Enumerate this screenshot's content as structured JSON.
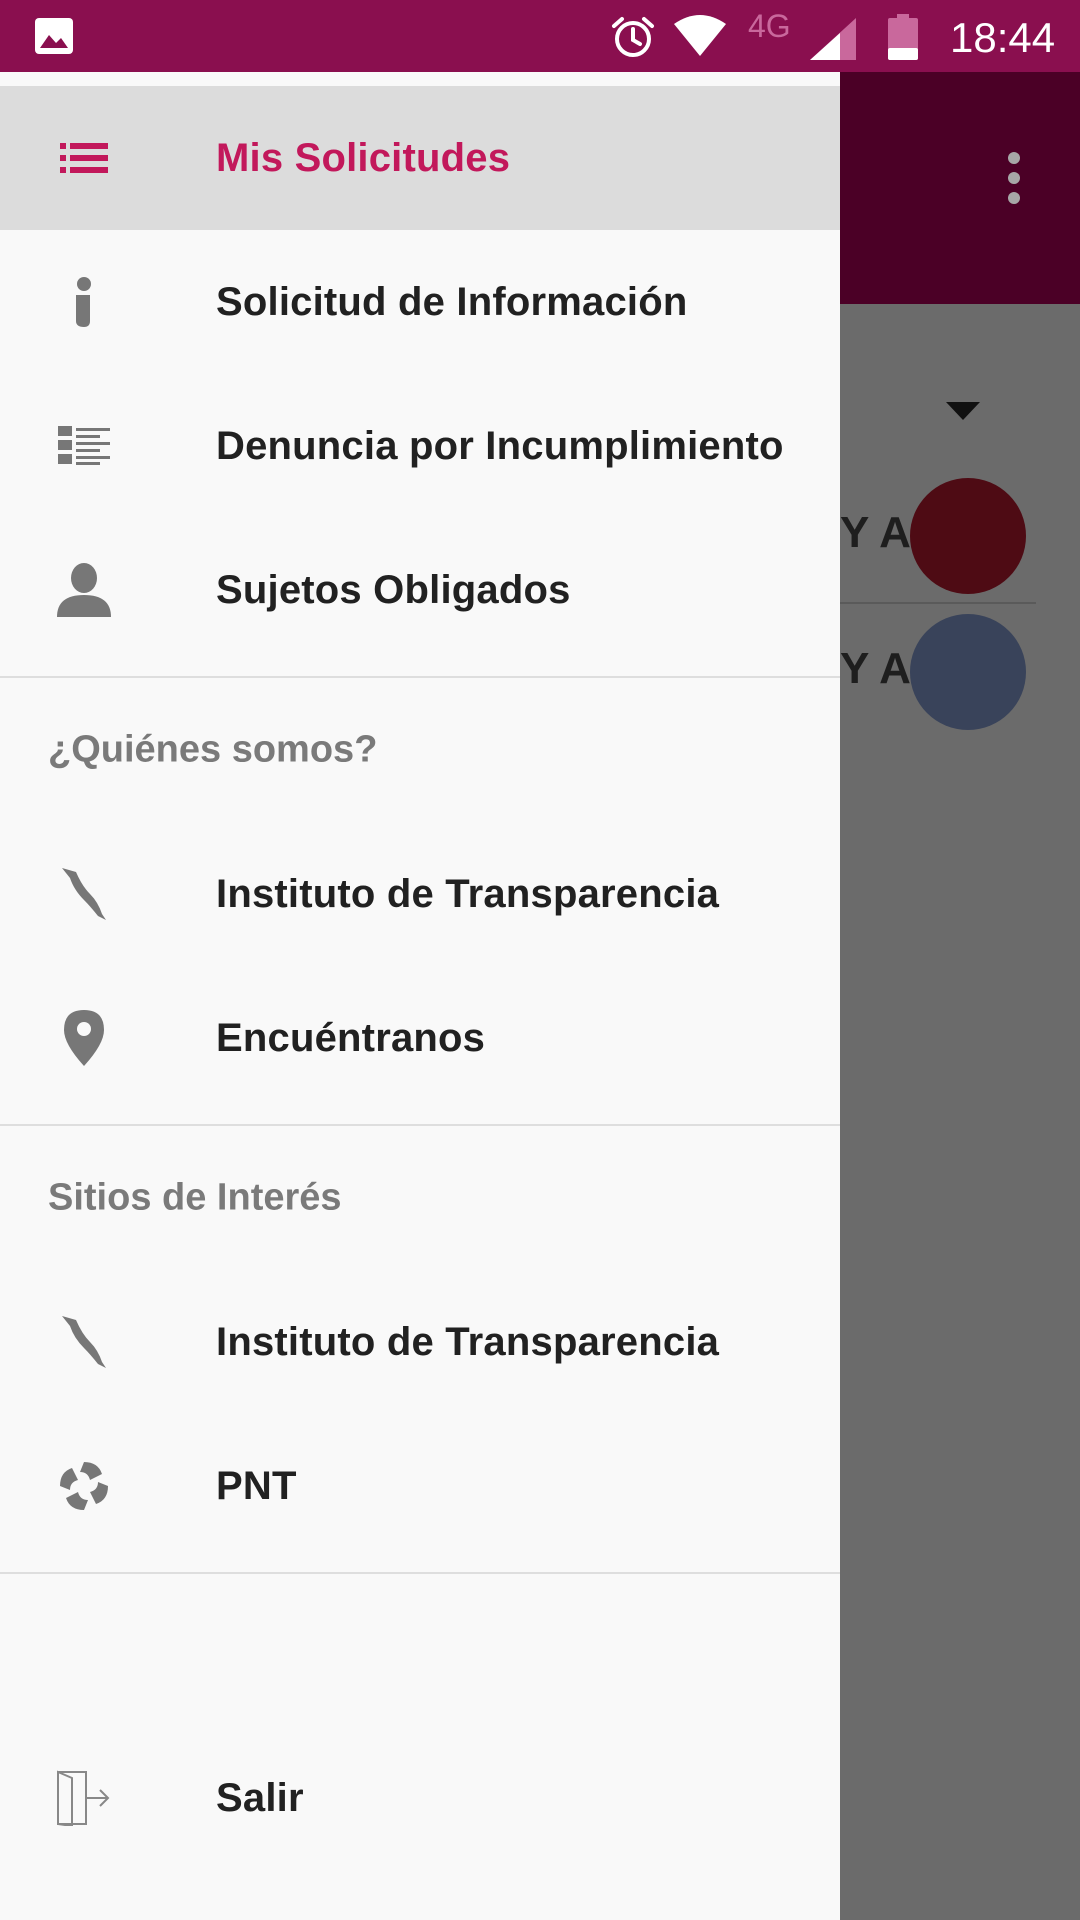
{
  "status_bar": {
    "network": "4G",
    "time": "18:44"
  },
  "background_app": {
    "row1_text": "Y A",
    "row2_text": "Y A",
    "colors": {
      "toolbar": "#4b0026",
      "avatar1": "#4e0b14",
      "avatar2": "#39435a"
    }
  },
  "drawer": {
    "accent": "#c2185b",
    "main_items": [
      {
        "label": "Mis Solicitudes",
        "icon": "list-icon",
        "selected": true
      },
      {
        "label": "Solicitud de Información",
        "icon": "info-icon"
      },
      {
        "label": "Denuncia por Incumplimiento",
        "icon": "report-list-icon"
      },
      {
        "label": "Sujetos Obligados",
        "icon": "person-icon"
      }
    ],
    "section_about": {
      "title": "¿Quiénes somos?",
      "items": [
        {
          "label": "Instituto de Transparencia",
          "icon": "state-map-icon"
        },
        {
          "label": "Encuéntranos",
          "icon": "location-pin-icon"
        }
      ]
    },
    "section_sites": {
      "title": "Sitios de Interés",
      "items": [
        {
          "label": "Instituto de Transparencia",
          "icon": "state-map-icon"
        },
        {
          "label": "PNT",
          "icon": "pnt-logo-icon"
        }
      ]
    },
    "logout": {
      "label": "Salir",
      "icon": "logout-door-icon"
    }
  }
}
